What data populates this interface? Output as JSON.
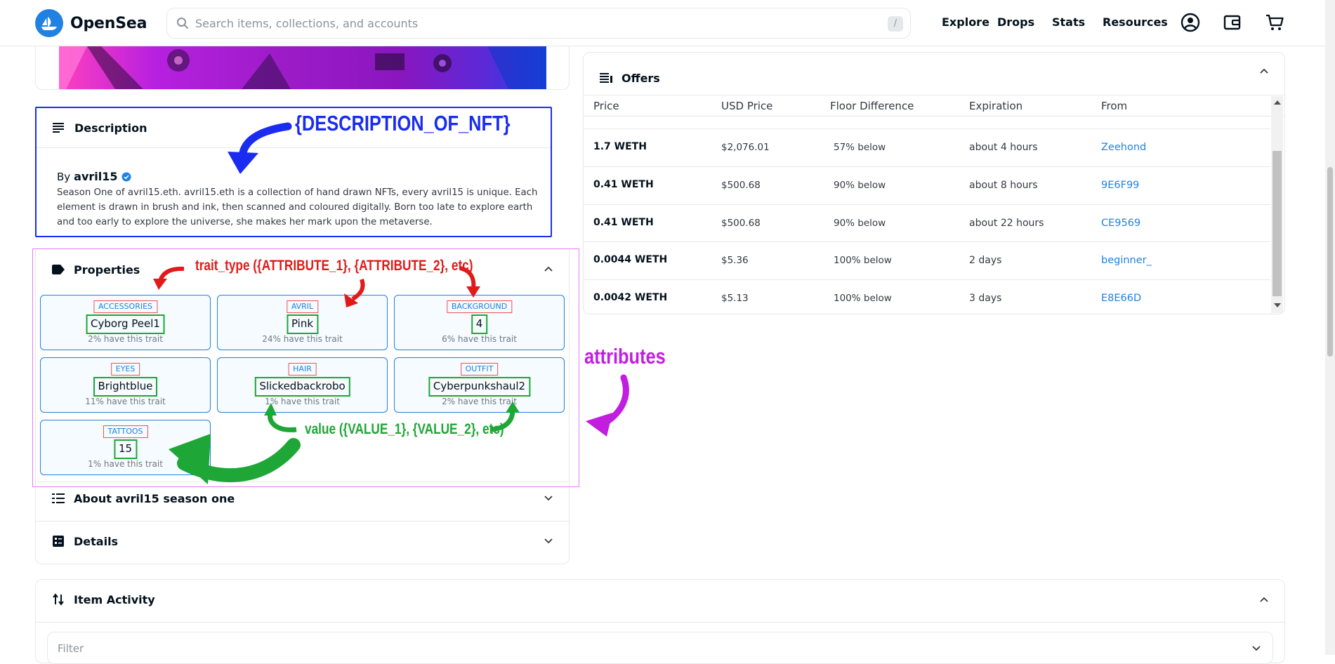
{
  "header": {
    "brand": "OpenSea",
    "search_placeholder": "Search items, collections, and accounts",
    "search_shortcut": "/",
    "nav": [
      "Explore",
      "Drops",
      "Stats",
      "Resources"
    ]
  },
  "description": {
    "title": "Description",
    "by_label": "By",
    "creator": "avril15",
    "text": "Season One of avril15.eth. avril15.eth is a collection of hand drawn NFTs, every avril15 is unique. Each element is drawn in brush and ink, then scanned and coloured digitally. Born too late to explore earth and too early to explore the universe, she makes her mark upon the metaverse."
  },
  "properties": {
    "title": "Properties",
    "traits": [
      {
        "type": "ACCESSORIES",
        "value": "Cyborg Peel1",
        "rarity": "2% have this trait"
      },
      {
        "type": "AVRIL",
        "value": "Pink",
        "rarity": "24% have this trait"
      },
      {
        "type": "BACKGROUND",
        "value": "4",
        "rarity": "6% have this trait"
      },
      {
        "type": "EYES",
        "value": "Brightblue",
        "rarity": "11% have this trait"
      },
      {
        "type": "HAIR",
        "value": "Slickedbackrobo",
        "rarity": "1% have this trait"
      },
      {
        "type": "OUTFIT",
        "value": "Cyberpunkshaul2",
        "rarity": "2% have this trait"
      },
      {
        "type": "TATTOOS",
        "value": "15",
        "rarity": "1% have this trait"
      }
    ]
  },
  "about": {
    "title": "About avril15 season one"
  },
  "details": {
    "title": "Details"
  },
  "offers": {
    "title": "Offers",
    "columns": [
      "Price",
      "USD Price",
      "Floor Difference",
      "Expiration",
      "From"
    ],
    "rows": [
      {
        "price": "1.7 WETH",
        "usd": "$2,076.01",
        "floor": "57% below",
        "expiration": "about 4 hours",
        "from": "Zeehond"
      },
      {
        "price": "0.41 WETH",
        "usd": "$500.68",
        "floor": "90% below",
        "expiration": "about 8 hours",
        "from": "9E6F99"
      },
      {
        "price": "0.41 WETH",
        "usd": "$500.68",
        "floor": "90% below",
        "expiration": "about 22 hours",
        "from": "CE9569"
      },
      {
        "price": "0.0044 WETH",
        "usd": "$5.36",
        "floor": "100% below",
        "expiration": "2 days",
        "from": "beginner_"
      },
      {
        "price": "0.0042 WETH",
        "usd": "$5.13",
        "floor": "100% below",
        "expiration": "3 days",
        "from": "E8E66D"
      }
    ]
  },
  "activity": {
    "title": "Item Activity",
    "filter_placeholder": "Filter"
  },
  "annotations": {
    "description": "{DESCRIPTION_OF_NFT}",
    "trait_type": "trait_type ({ATTRIBUTE_1}, {ATTRIBUTE_2}, etc)",
    "value": "value ({VALUE_1}, {VALUE_2}, etc)",
    "attributes": "attributes"
  },
  "colors": {
    "accent": "#2081e2",
    "annotation_blue": "#1a2cf0",
    "annotation_red": "#e11a1a",
    "annotation_green": "#1ea637",
    "annotation_purple": "#c21ee0"
  }
}
